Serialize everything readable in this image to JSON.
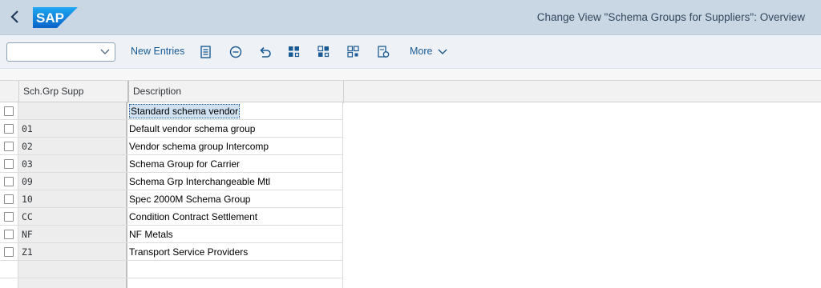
{
  "titlebar": {
    "back": "‹",
    "logo": "SAP",
    "title": "Change View \"Schema Groups for Suppliers\": Overview"
  },
  "toolbar": {
    "dropdown_value": "",
    "new_entries": "New Entries",
    "more": "More"
  },
  "table": {
    "columns": [
      "Sch.Grp Supp",
      "Description"
    ],
    "rows": [
      {
        "code": "",
        "description": "Standard schema vendor",
        "selected": true
      },
      {
        "code": "01",
        "description": "Default vendor schema group"
      },
      {
        "code": "02",
        "description": "Vendor schema group Intercomp"
      },
      {
        "code": "03",
        "description": "Schema Group for Carrier"
      },
      {
        "code": "09",
        "description": "Schema Grp Interchangeable Mtl"
      },
      {
        "code": "10",
        "description": "Spec 2000M Schema Group"
      },
      {
        "code": "CC",
        "description": "Condition Contract Settlement"
      },
      {
        "code": "NF",
        "description": "NF Metals"
      },
      {
        "code": "Z1",
        "description": "Transport Service Providers"
      }
    ]
  },
  "colors": {
    "titlebar_bg": "#c9d7e5",
    "accent": "#1a5a94",
    "logo_blue": "#0a6ed1"
  }
}
